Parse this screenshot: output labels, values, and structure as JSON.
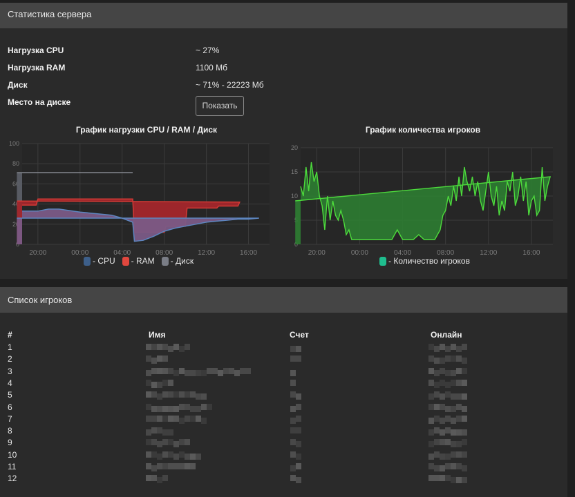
{
  "stats_panel": {
    "title": "Статистика сервера",
    "rows": [
      {
        "label": "Нагрузка CPU",
        "value": "~ 27%"
      },
      {
        "label": "Нагрузка RAM",
        "value": "1100 Мб"
      },
      {
        "label": "Диск",
        "value": "~ 71% - 22223 Мб"
      },
      {
        "label": "Место на диске",
        "value": ""
      }
    ],
    "show_button": "Показать"
  },
  "chart_data": [
    {
      "type": "area",
      "title": "График нагрузки CPU / RAM / Диск",
      "x_ticks": [
        "20:00",
        "00:00",
        "04:00",
        "08:00",
        "12:00",
        "16:00"
      ],
      "x_range": [
        "18:30",
        "18:00 (+1 day)"
      ],
      "ylim": [
        0,
        100
      ],
      "y_ticks": [
        0,
        20,
        40,
        60,
        80,
        100
      ],
      "grid": true,
      "legend": "bottom",
      "series": [
        {
          "name": "- Диск",
          "color": "#6c6f78",
          "x": [
            "18:30",
            "05:00",
            "05:00",
            "18:00"
          ],
          "values": [
            71,
            71,
            71,
            71
          ]
        },
        {
          "name": "- RAM",
          "color": "#c9302c",
          "x": [
            "18:30",
            "19:50",
            "20:00",
            "05:00",
            "05:10",
            "08:00",
            "08:10",
            "10:00",
            "10:10",
            "13:00",
            "13:10",
            "15:00",
            "15:10",
            "18:00"
          ],
          "values": [
            39,
            39,
            45,
            45,
            12,
            12,
            18,
            18,
            36,
            36,
            38,
            38,
            42,
            43
          ]
        },
        {
          "name": "- CPU",
          "color": "#3d5f8a",
          "x": [
            "18:30",
            "20:00",
            "21:00",
            "22:00",
            "00:00",
            "01:00",
            "02:00",
            "03:00",
            "04:00",
            "05:00",
            "05:10",
            "06:00",
            "07:00",
            "08:00",
            "09:00",
            "10:00",
            "11:00",
            "12:00",
            "13:00",
            "14:00",
            "15:00",
            "16:00",
            "17:00",
            "18:00"
          ],
          "values": [
            33,
            33,
            35,
            35,
            32,
            31,
            30,
            29,
            26,
            22,
            3,
            4,
            8,
            13,
            16,
            18,
            20,
            22,
            23,
            24,
            25,
            25,
            26,
            26
          ]
        }
      ]
    },
    {
      "type": "area",
      "title": "График количества игроков",
      "x_ticks": [
        "20:00",
        "00:00",
        "04:00",
        "08:00",
        "12:00",
        "16:00"
      ],
      "ylim": [
        0,
        20
      ],
      "y_ticks": [
        0,
        5,
        10,
        15,
        20
      ],
      "grid": true,
      "legend": "bottom",
      "series": [
        {
          "name": "- Количество игроков",
          "color": "#1fbd8e",
          "x": [
            "18:30",
            "18:45",
            "19:00",
            "19:15",
            "19:30",
            "19:45",
            "20:00",
            "20:15",
            "20:30",
            "20:45",
            "21:00",
            "21:15",
            "21:30",
            "21:45",
            "22:00",
            "22:15",
            "22:30",
            "22:45",
            "23:00",
            "23:15",
            "23:30",
            "23:45",
            "00:00",
            "00:30",
            "01:00",
            "01:30",
            "02:00",
            "02:30",
            "03:00",
            "03:30",
            "04:00",
            "04:30",
            "05:00",
            "05:30",
            "06:00",
            "06:30",
            "07:00",
            "07:15",
            "07:30",
            "07:45",
            "08:00",
            "08:15",
            "08:30",
            "08:45",
            "09:00",
            "09:15",
            "09:30",
            "09:45",
            "10:00",
            "10:15",
            "10:30",
            "10:45",
            "11:00",
            "11:15",
            "11:30",
            "11:45",
            "12:00",
            "12:15",
            "12:30",
            "12:45",
            "13:00",
            "13:15",
            "13:30",
            "13:45",
            "14:00",
            "14:15",
            "14:30",
            "14:45",
            "15:00",
            "15:15",
            "15:30",
            "15:45",
            "16:00",
            "16:15",
            "16:30",
            "16:45",
            "17:00",
            "17:15",
            "17:30",
            "17:45",
            "18:00"
          ],
          "values": [
            12,
            10,
            16,
            11,
            17,
            13,
            15,
            10,
            8,
            3,
            10,
            5,
            9,
            6,
            5,
            7,
            5,
            2,
            3,
            1,
            1,
            1,
            1,
            1,
            1,
            1,
            1,
            1,
            1,
            3,
            1,
            1,
            1,
            2,
            1,
            1,
            1,
            2,
            3,
            6,
            7,
            10,
            8,
            12,
            9,
            14,
            10,
            16,
            13,
            11,
            14,
            10,
            13,
            9,
            7,
            11,
            15,
            10,
            8,
            12,
            6,
            9,
            7,
            13,
            11,
            15,
            8,
            10,
            14,
            9,
            13,
            6,
            9,
            10,
            6,
            7,
            16,
            9,
            12,
            14,
            9
          ]
        }
      ]
    }
  ],
  "players_panel": {
    "title": "Список игроков",
    "columns": [
      "#",
      "Имя",
      "Счет",
      "Онлайн"
    ],
    "rows": [
      "1",
      "2",
      "3",
      "4",
      "5",
      "6",
      "7",
      "8",
      "9",
      "10",
      "11",
      "12"
    ]
  },
  "colors": {
    "page_bg": "#1f1f1f",
    "panel_bg": "#2a2a2a",
    "header_bg": "#454545",
    "grid": "#3c3c3c"
  }
}
